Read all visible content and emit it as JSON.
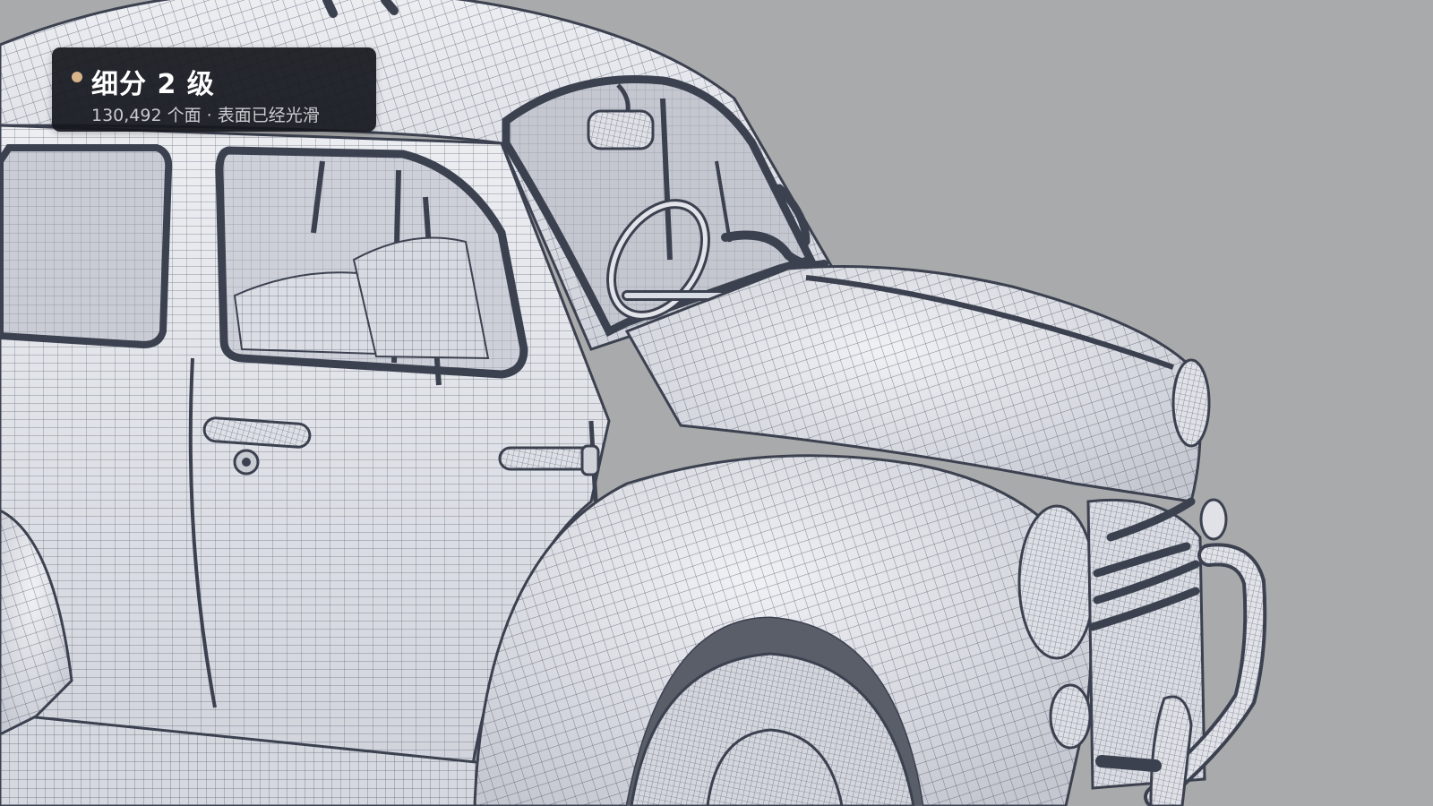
{
  "viewport": {
    "background": "#a9aaab",
    "mesh_stroke": "#3c4150",
    "surface_fill": "#e4e6ec",
    "surface_shadow": "#b9bcc6"
  },
  "overlay": {
    "indicator_color": "#d9b48a",
    "title": "细分 2 级",
    "subtitle": "130,492 个面 · 表面已经光滑"
  }
}
